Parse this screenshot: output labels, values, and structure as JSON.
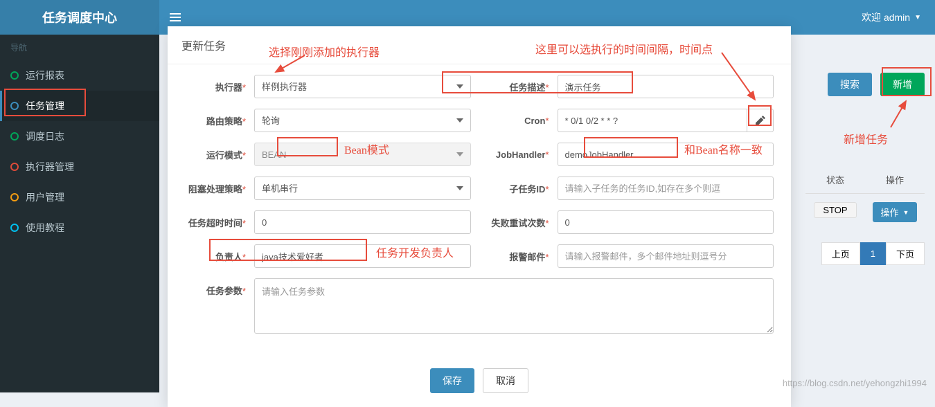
{
  "header": {
    "logo": "任务调度中心",
    "welcome": "欢迎 admin"
  },
  "sidebar": {
    "nav_header": "导航",
    "items": [
      {
        "label": "运行报表",
        "color": "c-green"
      },
      {
        "label": "任务管理",
        "color": "c-blue",
        "active": true
      },
      {
        "label": "调度日志",
        "color": "c-green"
      },
      {
        "label": "执行器管理",
        "color": "c-red"
      },
      {
        "label": "用户管理",
        "color": "c-yellow"
      },
      {
        "label": "使用教程",
        "color": "c-teal"
      }
    ]
  },
  "toolbar": {
    "search": "搜索",
    "add": "新增"
  },
  "table": {
    "col_status": "状态",
    "col_op": "操作",
    "stop": "STOP",
    "op_btn": "操作"
  },
  "pagination": {
    "prev": "上页",
    "page": "1",
    "next": "下页"
  },
  "modal": {
    "title": "更新任务",
    "fields": {
      "executor": {
        "label": "执行器",
        "value": "样例执行器"
      },
      "desc": {
        "label": "任务描述",
        "value": "演示任务"
      },
      "route": {
        "label": "路由策略",
        "value": "轮询"
      },
      "cron": {
        "label": "Cron",
        "value": "* 0/1 0/2 * * ?"
      },
      "mode": {
        "label": "运行模式",
        "value": "BEAN"
      },
      "handler": {
        "label": "JobHandler",
        "value": "demoJobHandler"
      },
      "block": {
        "label": "阻塞处理策略",
        "value": "单机串行"
      },
      "subtask": {
        "label": "子任务ID",
        "placeholder": "请输入子任务的任务ID,如存在多个则逗"
      },
      "timeout": {
        "label": "任务超时时间",
        "value": "0"
      },
      "retry": {
        "label": "失败重试次数",
        "value": "0"
      },
      "owner": {
        "label": "负责人",
        "value": "java技术爱好者"
      },
      "alarm": {
        "label": "报警邮件",
        "placeholder": "请输入报警邮件，多个邮件地址则逗号分"
      },
      "params": {
        "label": "任务参数",
        "placeholder": "请输入任务参数"
      }
    },
    "save": "保存",
    "cancel": "取消"
  },
  "annotations": {
    "a1": "选择刚刚添加的执行器",
    "a2": "这里可以选执行的时间间隔，时间点",
    "a3": "Bean模式",
    "a4": "和Bean名称一致",
    "a5": "任务开发负责人",
    "a6": "新增任务"
  },
  "watermark": "https://blog.csdn.net/yehongzhi1994"
}
